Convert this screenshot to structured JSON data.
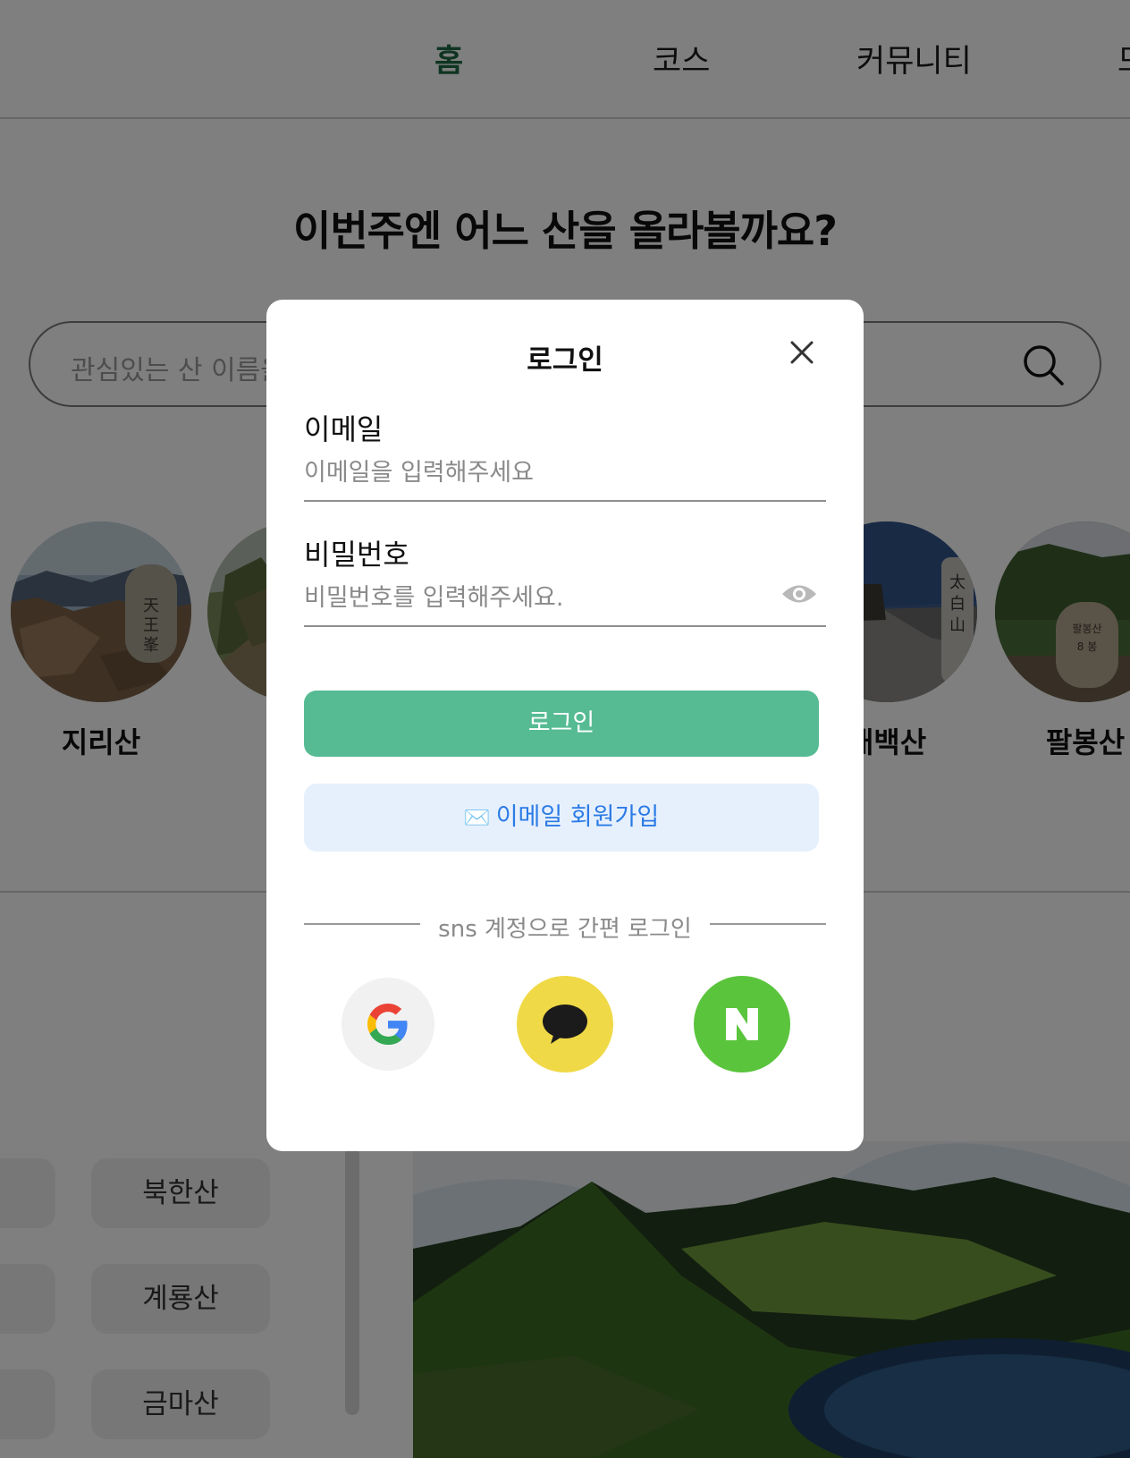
{
  "nav": {
    "home": "홈",
    "course": "코스",
    "community": "커뮤니티",
    "more": "모"
  },
  "hero": {
    "title": "이번주엔 어느 산을 올라볼까요?"
  },
  "search": {
    "placeholder": "관심있는 산 이름을 입력해주세요"
  },
  "mountains": [
    "지리산",
    "",
    "태백산",
    "팔봉산"
  ],
  "chips": {
    "left": [
      "",
      "",
      ""
    ],
    "right": [
      "북한산",
      "계룡산",
      "금마산"
    ]
  },
  "modal": {
    "title": "로그인",
    "email_label": "이메일",
    "email_placeholder": "이메일을 입력해주세요",
    "password_label": "비밀번호",
    "password_placeholder": "비밀번호를 입력해주세요.",
    "login_button": "로그인",
    "signup_icon": "✉️",
    "signup_button": "이메일 회원가입",
    "sns_divider": "sns 계정으로 간편 로그인"
  },
  "sns": [
    "google-icon",
    "kakao-icon",
    "naver-icon"
  ],
  "colors": {
    "brand_green": "#56bb93",
    "nav_active": "#1f6b45",
    "kakao": "#f0d947",
    "naver": "#5ac43c",
    "signup_bg": "#e6f0fd",
    "signup_text": "#2c7be5"
  }
}
